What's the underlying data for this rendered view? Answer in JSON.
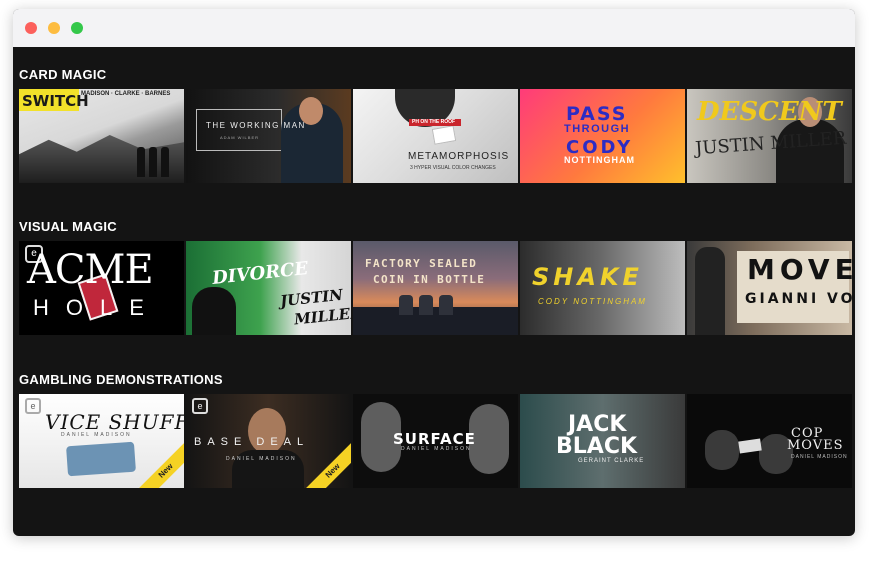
{
  "window": {
    "buttons": [
      "close",
      "minimize",
      "maximize"
    ]
  },
  "sections": [
    {
      "title": "CARD MAGIC",
      "items": [
        {
          "title": "SWITCH",
          "subtitle": "MADISON · CLARKE · BARNES"
        },
        {
          "title": "THE WORKING MAN",
          "subtitle": "ADAM WILBER"
        },
        {
          "title": "METAMORPHOSIS",
          "subtitle": "3 HYPER VISUAL COLOR CHANGES",
          "badge": "PH ON THE ROOF"
        },
        {
          "title": "PASS",
          "title2": "THROUGH",
          "title3": "CODY",
          "subtitle": "NOTTINGHAM"
        },
        {
          "title": "DESCENT",
          "subtitle": "JUSTIN MILLER"
        }
      ]
    },
    {
      "title": "VISUAL MAGIC",
      "items": [
        {
          "title": "ACME",
          "title2": "HOLE"
        },
        {
          "title": "DIVORCE",
          "subtitle": "JUSTIN",
          "subtitle2": "MILLER"
        },
        {
          "title": "FACTORY SEALED",
          "subtitle": "COIN IN BOTTLE"
        },
        {
          "title": "SHAKE",
          "subtitle": "CODY NOTTINGHAM"
        },
        {
          "title": "MOVE",
          "subtitle": "GIANNI VOX"
        }
      ]
    },
    {
      "title": "GAMBLING DEMONSTRATIONS",
      "items": [
        {
          "title": "VICE SHUFFLE",
          "subtitle": "DANIEL MADISON",
          "ribbon": "New"
        },
        {
          "title": "BASE DEAL",
          "subtitle": "DANIEL MADISON",
          "ribbon": "New"
        },
        {
          "title": "SURFACE",
          "subtitle": "DANIEL MADISON"
        },
        {
          "title": "JACK",
          "title2": "BLACK",
          "subtitle": "GERAINT CLARKE"
        },
        {
          "title": "COP",
          "title2": "MOVES",
          "subtitle": "DANIEL MADISON"
        }
      ]
    }
  ],
  "colors": {
    "window_bg": "#141414",
    "titlebar_bg": "#f3f3f5",
    "close": "#fc605c",
    "minimize": "#fdbc40",
    "maximize": "#34c84a",
    "ribbon": "#f5d224"
  }
}
